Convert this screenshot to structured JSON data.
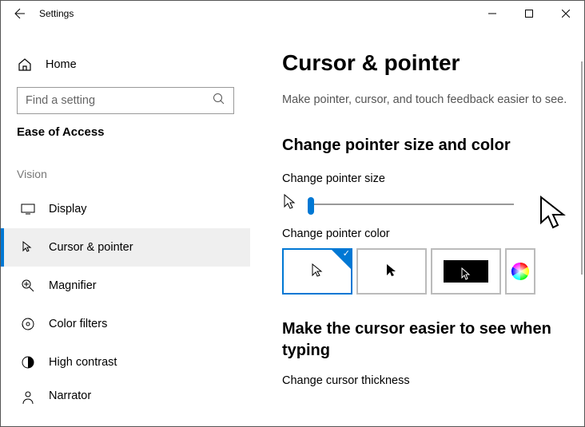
{
  "window": {
    "title": "Settings"
  },
  "sidebar": {
    "home_label": "Home",
    "search_placeholder": "Find a setting",
    "category": "Ease of Access",
    "group_label": "Vision",
    "items": [
      {
        "label": "Display"
      },
      {
        "label": "Cursor & pointer"
      },
      {
        "label": "Magnifier"
      },
      {
        "label": "Color filters"
      },
      {
        "label": "High contrast"
      },
      {
        "label": "Narrator"
      }
    ]
  },
  "main": {
    "heading": "Cursor & pointer",
    "subtitle": "Make pointer, cursor, and touch feedback easier to see.",
    "section1_head": "Change pointer size and color",
    "size_label": "Change pointer size",
    "color_label": "Change pointer color",
    "section2_head": "Make the cursor easier to see when typing",
    "thickness_label": "Change cursor thickness"
  }
}
